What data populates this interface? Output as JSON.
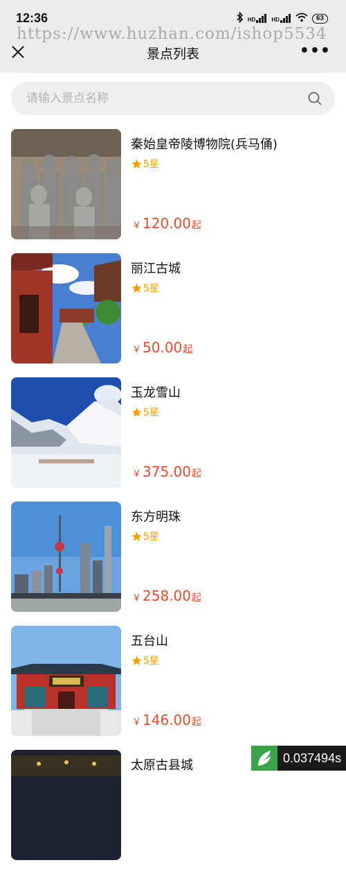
{
  "status_bar": {
    "time": "12:36",
    "battery": "63",
    "signal_label_1": "HD",
    "signal_label_2": "HD"
  },
  "watermark": "https://www.huzhan.com/ishop5534",
  "header": {
    "title": "景点列表",
    "close_icon": "close-icon",
    "more_icon": "more-icon",
    "more_label": "•••"
  },
  "search": {
    "placeholder": "请输入景点名称",
    "value": "",
    "icon": "search-icon"
  },
  "colors": {
    "price": "#e54d2e",
    "star": "#f0a100",
    "search_bg": "#efefef",
    "header_bg": "#ececec"
  },
  "items": [
    {
      "name": "秦始皇帝陵博物院(兵马俑)",
      "rating": "5星",
      "currency": "￥",
      "price": "120.00",
      "suffix": "起",
      "image": "terracotta-warriors"
    },
    {
      "name": "丽江古城",
      "rating": "5星",
      "currency": "￥",
      "price": "50.00",
      "suffix": "起",
      "image": "lijiang-old-town"
    },
    {
      "name": "玉龙雪山",
      "rating": "5星",
      "currency": "￥",
      "price": "375.00",
      "suffix": "起",
      "image": "snow-mountain"
    },
    {
      "name": "东方明珠",
      "rating": "5星",
      "currency": "￥",
      "price": "258.00",
      "suffix": "起",
      "image": "oriental-pearl-tower"
    },
    {
      "name": "五台山",
      "rating": "5星",
      "currency": "￥",
      "price": "146.00",
      "suffix": "起",
      "image": "wutai-temple"
    },
    {
      "name": "太原古县城",
      "rating": "",
      "currency": "",
      "price": "",
      "suffix": "",
      "image": "taiyuan-old-town"
    }
  ],
  "timer_badge": {
    "value": "0.037494s"
  }
}
